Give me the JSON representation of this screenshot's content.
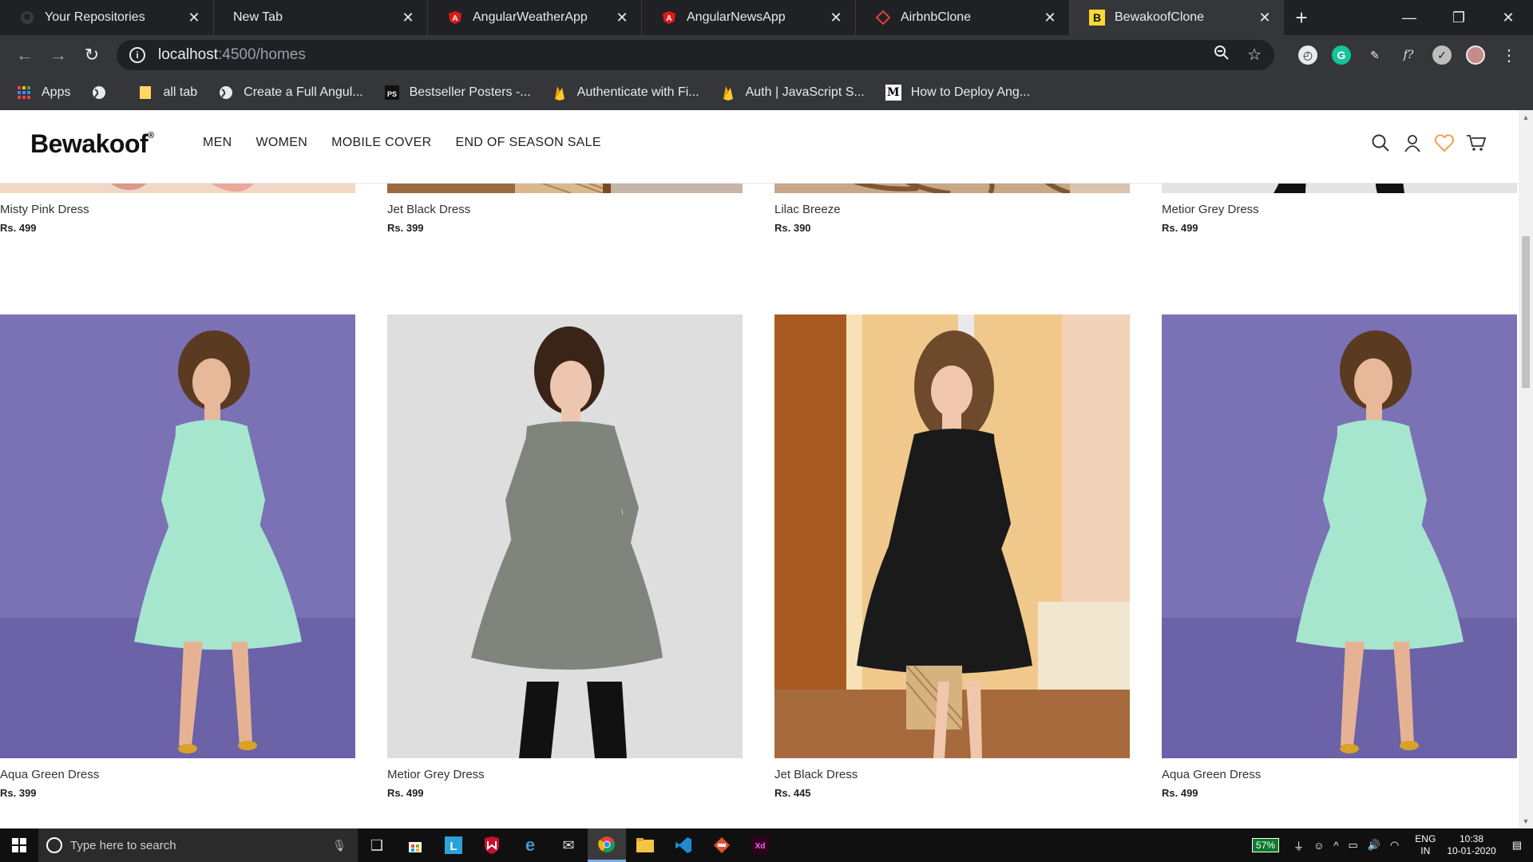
{
  "browser": {
    "tabs": [
      {
        "title": "Your Repositories",
        "icon": "github-icon"
      },
      {
        "title": "New Tab",
        "icon": "none"
      },
      {
        "title": "AngularWeatherApp",
        "icon": "angular-icon"
      },
      {
        "title": "AngularNewsApp",
        "icon": "angular-icon"
      },
      {
        "title": "AirbnbClone",
        "icon": "diamond-icon"
      },
      {
        "title": "BewakoofClone",
        "icon": "b-icon"
      }
    ],
    "url_host": "localhost",
    "url_path": ":4500/homes",
    "bookmarks": [
      {
        "label": "Apps"
      },
      {
        "label": ""
      },
      {
        "label": "all tab"
      },
      {
        "label": "Create a Full Angul..."
      },
      {
        "label": "Bestseller Posters -..."
      },
      {
        "label": "Authenticate with Fi..."
      },
      {
        "label": "Auth | JavaScript S..."
      },
      {
        "label": "How to Deploy Ang..."
      }
    ]
  },
  "site": {
    "logo": "Bewakoof",
    "logo_mark": "®",
    "nav": [
      "MEN",
      "WOMEN",
      "MOBILE COVER",
      "END OF SEASON SALE"
    ]
  },
  "products_top": [
    {
      "name": "Misty Pink Dress",
      "price": "Rs. 499",
      "bg": "#e6c4b0"
    },
    {
      "name": "Jet Black Dress",
      "price": "Rs. 399",
      "bg": "#7a4c2a"
    },
    {
      "name": "Lilac Breeze",
      "price": "Rs. 390",
      "bg": "#c8a88a"
    },
    {
      "name": "Metior Grey Dress",
      "price": "Rs. 499",
      "bg": "#e2e2e2"
    }
  ],
  "products_main": [
    {
      "name": "Aqua Green Dress",
      "price": "Rs. 399",
      "bg": "#7a72b5",
      "dress": "#a6e6cf"
    },
    {
      "name": "Metior Grey Dress",
      "price": "Rs. 499",
      "bg": "#dcdcdc",
      "dress": "#7f857c"
    },
    {
      "name": "Jet Black Dress",
      "price": "Rs. 445",
      "bg": "#efc78f",
      "dress": "#1a1a1a"
    },
    {
      "name": "Aqua Green Dress",
      "price": "Rs. 499",
      "bg": "#7a72b5",
      "dress": "#a6e6cf"
    }
  ],
  "taskbar": {
    "search_placeholder": "Type here to search",
    "battery": "57%",
    "lang_line1": "ENG",
    "lang_line2": "IN",
    "time": "10:38",
    "date": "10-01-2020"
  }
}
